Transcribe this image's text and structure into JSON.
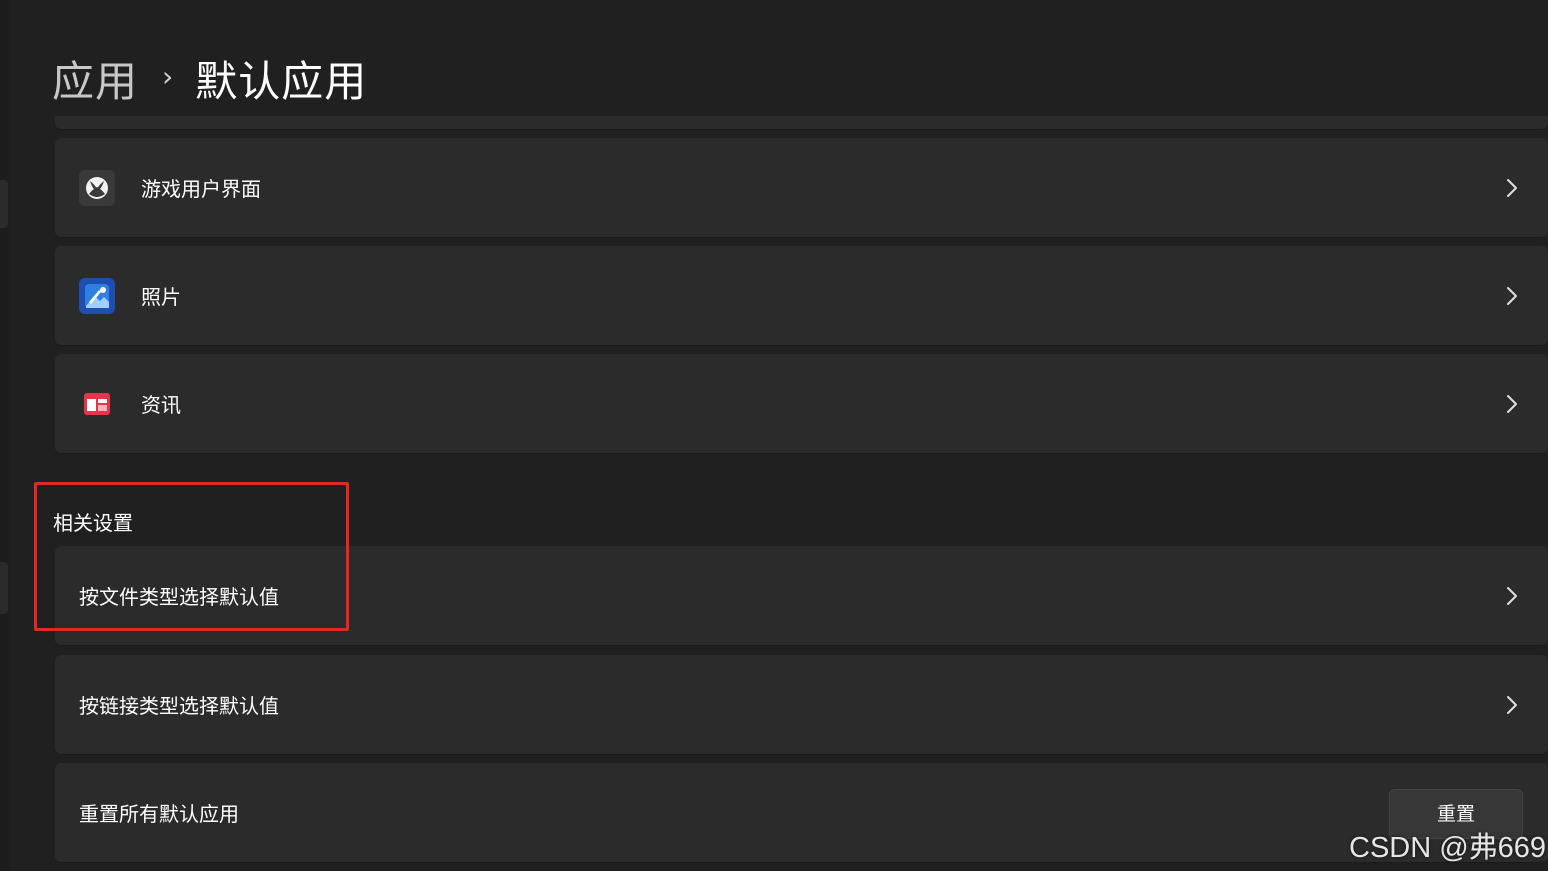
{
  "breadcrumb": {
    "parent": "应用",
    "separator": "›",
    "current": "默认应用"
  },
  "apps": [
    {
      "label": "游戏用户界面",
      "icon": "xbox-icon"
    },
    {
      "label": "照片",
      "icon": "photos-icon"
    },
    {
      "label": "资讯",
      "icon": "news-icon"
    }
  ],
  "related": {
    "title": "相关设置",
    "items": [
      {
        "label": "按文件类型选择默认值"
      },
      {
        "label": "按链接类型选择默认值"
      }
    ],
    "reset": {
      "label": "重置所有默认应用",
      "button_label": "重置"
    }
  },
  "watermark": "CSDN @弗669",
  "colors": {
    "background": "#202020",
    "card": "#2b2b2b",
    "annotation": "#e8261e",
    "photos_accent": "#2f7fe0",
    "news_accent": "#e8344a"
  }
}
